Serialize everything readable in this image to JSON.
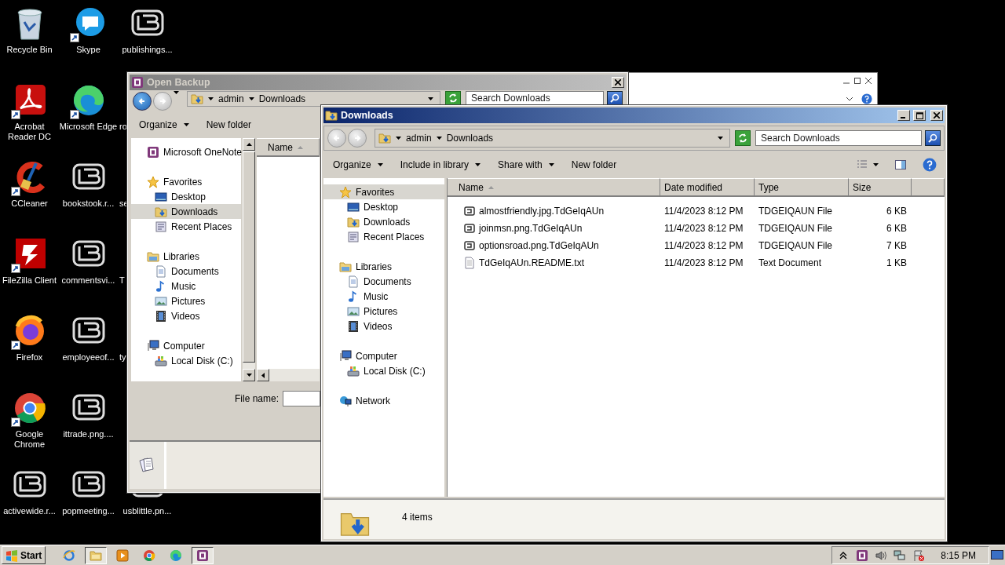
{
  "desktop": {
    "columns": [
      [
        {
          "label": "Recycle Bin",
          "kind": "recycle",
          "shortcut": false
        },
        {
          "label": "Acrobat Reader DC",
          "kind": "acrobat",
          "shortcut": true
        },
        {
          "label": "CCleaner",
          "kind": "ccleaner",
          "shortcut": true
        },
        {
          "label": "FileZilla Client",
          "kind": "filezilla",
          "shortcut": true
        },
        {
          "label": "Firefox",
          "kind": "firefox",
          "shortcut": true
        },
        {
          "label": "Google Chrome",
          "kind": "chrome",
          "shortcut": true
        },
        {
          "label": "activewide.r...",
          "kind": "file",
          "shortcut": false
        }
      ],
      [
        {
          "label": "Skype",
          "kind": "skype",
          "shortcut": true
        },
        {
          "label": "Microsoft Edge",
          "kind": "edge",
          "shortcut": true
        },
        {
          "label": "bookstook.r...",
          "kind": "file",
          "shortcut": false
        },
        {
          "label": "commentsvi...",
          "kind": "file",
          "shortcut": false
        },
        {
          "label": "employeeof...",
          "kind": "file",
          "shortcut": false
        },
        {
          "label": "ittrade.png....",
          "kind": "file",
          "shortcut": false
        },
        {
          "label": "popmeeting...",
          "kind": "file",
          "shortcut": false
        }
      ],
      [
        {
          "label": "publishings...",
          "kind": "file",
          "shortcut": false
        },
        {
          "label": "ro",
          "kind": "cut"
        },
        {
          "label": "se",
          "kind": "cut"
        },
        {
          "label": "T",
          "kind": "cut"
        },
        {
          "label": "ty",
          "kind": "cut"
        },
        {
          "label": "usblittle.pn...",
          "kind": "file",
          "shortcut": false
        }
      ]
    ]
  },
  "open_backup": {
    "kind": "dialog",
    "title": "Open Backup",
    "active": false,
    "nav_buttons": [
      {
        "kind": "back",
        "disabled": false
      },
      {
        "kind": "forward",
        "disabled": true
      }
    ],
    "breadcrumb": [
      "admin",
      "Downloads"
    ],
    "search": {
      "placeholder": "Search Downloads"
    },
    "toolbar": [
      {
        "label": "Organize",
        "menu": true
      },
      {
        "label": "New folder",
        "menu": false
      }
    ],
    "nav": [
      {
        "label": "Microsoft OneNote",
        "kind": "onenote",
        "selected": false
      },
      {
        "label": "Favorites",
        "kind": "favorites",
        "selected": false,
        "children": [
          {
            "label": "Desktop",
            "kind": "desktop",
            "selected": false
          },
          {
            "label": "Downloads",
            "kind": "downloads",
            "selected": true
          },
          {
            "label": "Recent Places",
            "kind": "recent",
            "selected": false
          }
        ]
      },
      {
        "label": "Libraries",
        "kind": "libraries",
        "selected": false,
        "children": [
          {
            "label": "Documents",
            "kind": "documents",
            "selected": false
          },
          {
            "label": "Music",
            "kind": "music",
            "selected": false
          },
          {
            "label": "Pictures",
            "kind": "pictures",
            "selected": false
          },
          {
            "label": "Videos",
            "kind": "videos",
            "selected": false
          }
        ]
      },
      {
        "label": "Computer",
        "kind": "computer",
        "selected": false,
        "children": [
          {
            "label": "Local Disk (C:)",
            "kind": "disk",
            "selected": false
          }
        ]
      }
    ],
    "columns": [
      {
        "label": "Name",
        "sorted": true
      }
    ],
    "file_name": {
      "label": "File name:"
    }
  },
  "downloads": {
    "kind": "explorer",
    "title": "Downloads",
    "active": true,
    "nav_buttons": [
      {
        "kind": "back",
        "disabled": true
      },
      {
        "kind": "forward",
        "disabled": true
      }
    ],
    "breadcrumb": [
      "admin",
      "Downloads"
    ],
    "search": {
      "placeholder": "Search Downloads"
    },
    "toolbar": [
      {
        "label": "Organize",
        "menu": true
      },
      {
        "label": "Include in library",
        "menu": true
      },
      {
        "label": "Share with",
        "menu": true
      },
      {
        "label": "New folder",
        "menu": false
      }
    ],
    "nav": [
      {
        "label": "Favorites",
        "kind": "favorites",
        "selected": true,
        "children": [
          {
            "label": "Desktop",
            "kind": "desktop",
            "selected": false
          },
          {
            "label": "Downloads",
            "kind": "downloads",
            "selected": false
          },
          {
            "label": "Recent Places",
            "kind": "recent",
            "selected": false
          }
        ]
      },
      {
        "label": "Libraries",
        "kind": "libraries",
        "selected": false,
        "children": [
          {
            "label": "Documents",
            "kind": "documents",
            "selected": false
          },
          {
            "label": "Music",
            "kind": "music",
            "selected": false
          },
          {
            "label": "Pictures",
            "kind": "pictures",
            "selected": false
          },
          {
            "label": "Videos",
            "kind": "videos",
            "selected": false
          }
        ]
      },
      {
        "label": "Computer",
        "kind": "computer",
        "selected": false,
        "children": [
          {
            "label": "Local Disk (C:)",
            "kind": "disk",
            "selected": false
          }
        ]
      },
      {
        "label": "Network",
        "kind": "network",
        "selected": false
      }
    ],
    "columns": [
      {
        "label": "Name",
        "sorted": true
      },
      {
        "label": "Date modified",
        "sorted": false
      },
      {
        "label": "Type",
        "sorted": false
      },
      {
        "label": "Size",
        "sorted": false
      }
    ],
    "rows": [
      {
        "name": "almostfriendly.jpg.TdGeIqAUn",
        "date": "11/4/2023 8:12 PM",
        "type": "TDGEIQAUN File",
        "size": "6 KB",
        "kind": "locked"
      },
      {
        "name": "joinmsn.png.TdGeIqAUn",
        "date": "11/4/2023 8:12 PM",
        "type": "TDGEIQAUN File",
        "size": "6 KB",
        "kind": "locked"
      },
      {
        "name": "optionsroad.png.TdGeIqAUn",
        "date": "11/4/2023 8:12 PM",
        "type": "TDGEIQAUN File",
        "size": "7 KB",
        "kind": "locked"
      },
      {
        "name": "TdGeIqAUn.README.txt",
        "date": "11/4/2023 8:12 PM",
        "type": "Text Document",
        "size": "1 KB",
        "kind": "text"
      }
    ],
    "status": "4 items"
  },
  "taskbar": {
    "start": "Start",
    "apps": [
      {
        "kind": "ie",
        "selected": false
      },
      {
        "kind": "explorer",
        "selected": true
      },
      {
        "kind": "media",
        "selected": false
      },
      {
        "kind": "chrome",
        "selected": false
      },
      {
        "kind": "edge",
        "selected": false
      },
      {
        "kind": "onenote",
        "selected": true
      }
    ],
    "tray": [
      {
        "kind": "chevron"
      },
      {
        "kind": "onenote"
      },
      {
        "kind": "speaker"
      },
      {
        "kind": "network"
      },
      {
        "kind": "flag"
      }
    ],
    "clock": "8:15 PM"
  }
}
